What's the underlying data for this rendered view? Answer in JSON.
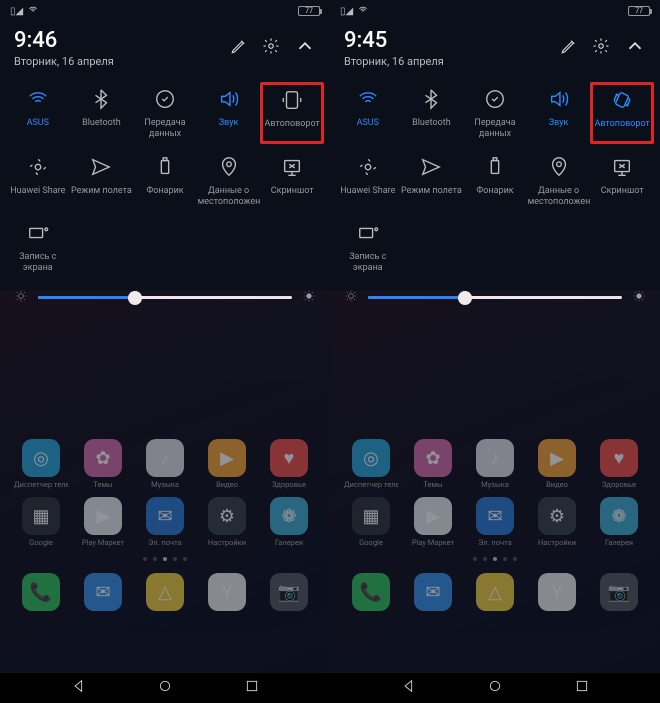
{
  "phones": [
    {
      "status": {
        "battery": "77"
      },
      "header": {
        "time": "9:46",
        "date": "Вторник, 16 апреля"
      },
      "qs_row1": [
        {
          "label": "ASUS",
          "active": true,
          "icon": "wifi"
        },
        {
          "label": "Bluetooth",
          "active": false,
          "icon": "bt"
        },
        {
          "label": "Передача данных",
          "active": false,
          "icon": "data"
        },
        {
          "label": "Звук",
          "active": true,
          "icon": "sound"
        },
        {
          "label": "Автоповорот",
          "active": false,
          "icon": "rotate-off",
          "highlight": true
        }
      ],
      "qs_row2": [
        {
          "label": "Huawei Share",
          "active": false,
          "icon": "share"
        },
        {
          "label": "Режим полета",
          "active": false,
          "icon": "plane"
        },
        {
          "label": "Фонарик",
          "active": false,
          "icon": "flash"
        },
        {
          "label": "Данные о местоположении",
          "active": false,
          "icon": "pin"
        },
        {
          "label": "Скриншот",
          "active": false,
          "icon": "screenshot"
        }
      ],
      "qs_row3": [
        {
          "label": "Запись с экрана",
          "active": false,
          "icon": "record"
        }
      ],
      "brightness": 38
    },
    {
      "status": {
        "battery": "77"
      },
      "header": {
        "time": "9:45",
        "date": "Вторник, 16 апреля"
      },
      "qs_row1": [
        {
          "label": "ASUS",
          "active": true,
          "icon": "wifi"
        },
        {
          "label": "Bluetooth",
          "active": false,
          "icon": "bt"
        },
        {
          "label": "Передача данных",
          "active": false,
          "icon": "data"
        },
        {
          "label": "Звук",
          "active": true,
          "icon": "sound"
        },
        {
          "label": "Автоповорот",
          "active": true,
          "icon": "rotate-on",
          "highlight": true
        }
      ],
      "qs_row2": [
        {
          "label": "Huawei Share",
          "active": false,
          "icon": "share"
        },
        {
          "label": "Режим полета",
          "active": false,
          "icon": "plane"
        },
        {
          "label": "Фонарик",
          "active": false,
          "icon": "flash"
        },
        {
          "label": "Данные о местоположении",
          "active": false,
          "icon": "pin"
        },
        {
          "label": "Скриншот",
          "active": false,
          "icon": "screenshot"
        }
      ],
      "qs_row3": [
        {
          "label": "Запись с экрана",
          "active": false,
          "icon": "record"
        }
      ],
      "brightness": 38
    }
  ],
  "apps": {
    "row1": [
      {
        "label": "Диспетчер телефона",
        "bg": "#2da6d8",
        "glyph": "◎"
      },
      {
        "label": "Темы",
        "bg": "#d46fae",
        "glyph": "✿"
      },
      {
        "label": "Музыка",
        "bg": "#e0e2e8",
        "glyph": "♪"
      },
      {
        "label": "Видео",
        "bg": "#f4a53c",
        "glyph": "▶"
      },
      {
        "label": "Здоровье",
        "bg": "#ef5350",
        "glyph": "♥"
      }
    ],
    "row2": [
      {
        "label": "Google",
        "bg": "#303640",
        "glyph": "▦"
      },
      {
        "label": "Play Маркет",
        "bg": "#e8edf2",
        "glyph": "▶"
      },
      {
        "label": "Эл. почта",
        "bg": "#2f7ed8",
        "glyph": "✉"
      },
      {
        "label": "Настройки",
        "bg": "#3a424d",
        "glyph": "⚙"
      },
      {
        "label": "Галерея",
        "bg": "#42b0d6",
        "glyph": "❁"
      }
    ],
    "dock": [
      {
        "label": "",
        "bg": "#33c15f",
        "glyph": "📞"
      },
      {
        "label": "",
        "bg": "#3994ec",
        "glyph": "✉"
      },
      {
        "label": "",
        "bg": "#f0cf42",
        "glyph": "△"
      },
      {
        "label": "",
        "bg": "#ededf0",
        "glyph": "Y"
      },
      {
        "label": "",
        "bg": "#555b66",
        "glyph": "📷"
      }
    ]
  }
}
